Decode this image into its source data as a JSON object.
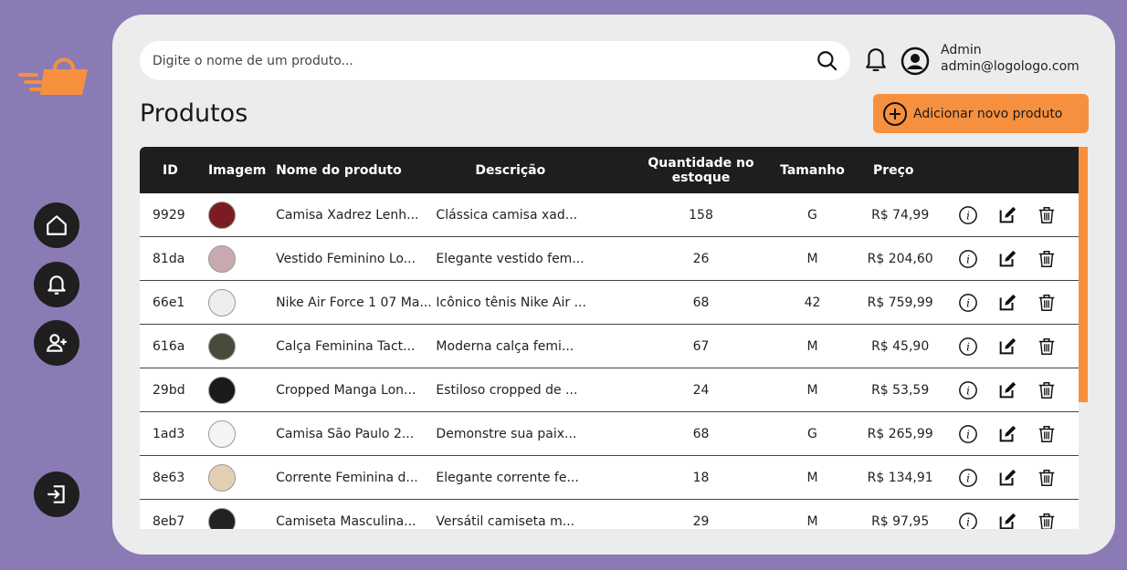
{
  "search": {
    "placeholder": "Digite o nome de um produto..."
  },
  "user": {
    "name": "Admin",
    "email": "admin@logologo.com"
  },
  "page": {
    "title": "Produtos"
  },
  "actions": {
    "add_label": "Adicionar novo produto"
  },
  "colors": {
    "accent": "#f7903e",
    "background": "#8b7bb5",
    "panel": "#ececec",
    "header": "#1e1e1e"
  },
  "table": {
    "headers": [
      "ID",
      "Imagem",
      "Nome do produto",
      "Descrição",
      "Quantidade no estoque",
      "Tamanho",
      "Preço"
    ],
    "rows": [
      {
        "id": "9929",
        "name": "Camisa Xadrez Lenh...",
        "desc": "Clássica camisa xad...",
        "qty": "158",
        "size": "G",
        "price": "R$ 74,99",
        "img": "#7a1c22"
      },
      {
        "id": "81da",
        "name": "Vestido Feminino Lo...",
        "desc": "Elegante vestido fem...",
        "qty": "26",
        "size": "M",
        "price": "R$ 204,60",
        "img": "#c9a9b0"
      },
      {
        "id": "66e1",
        "name": "Nike Air Force 1 07 Ma...",
        "desc": "Icônico tênis Nike Air ...",
        "qty": "68",
        "size": "42",
        "price": "R$ 759,99",
        "img": "#eeeeee"
      },
      {
        "id": "616a",
        "name": "Calça Feminina Tact...",
        "desc": "Moderna calça femi...",
        "qty": "67",
        "size": "M",
        "price": "R$ 45,90",
        "img": "#4a4a3c"
      },
      {
        "id": "29bd",
        "name": "Cropped Manga Lon...",
        "desc": "Estiloso cropped de ...",
        "qty": "24",
        "size": "M",
        "price": "R$ 53,59",
        "img": "#1a1a1a"
      },
      {
        "id": "1ad3",
        "name": "Camisa São Paulo 2...",
        "desc": "Demonstre sua paix...",
        "qty": "68",
        "size": "G",
        "price": "R$ 265,99",
        "img": "#f4f4f4"
      },
      {
        "id": "8e63",
        "name": "Corrente Feminina d...",
        "desc": "Elegante corrente fe...",
        "qty": "18",
        "size": "M",
        "price": "R$ 134,91",
        "img": "#e2cfb4"
      },
      {
        "id": "8eb7",
        "name": "Camiseta Masculina...",
        "desc": "Versátil camiseta m...",
        "qty": "29",
        "size": "M",
        "price": "R$ 97,95",
        "img": "#222222"
      }
    ]
  }
}
